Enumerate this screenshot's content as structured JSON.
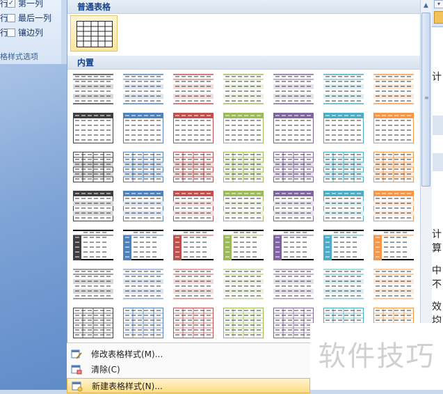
{
  "ribbon": {
    "options": [
      {
        "prefix": "行",
        "label": "第一列",
        "checked": true
      },
      {
        "prefix": "行",
        "label": "最后一列",
        "checked": false
      },
      {
        "prefix": "行",
        "label": "镶边列",
        "checked": false
      }
    ],
    "group_label": "格样式选项"
  },
  "gallery": {
    "plain_section": "普通表格",
    "builtin_section": "内置",
    "style_colors": [
      "#3f3f3f",
      "#4f81bd",
      "#c0504d",
      "#9bbb59",
      "#8064a2",
      "#4bacc6",
      "#f79646"
    ],
    "tint_colors": [
      "#d9d9d9",
      "#dbe5f1",
      "#f2dcdb",
      "#ebf1de",
      "#e5e0ec",
      "#daeef3",
      "#fde9d9"
    ],
    "row_kinds": [
      "light-lines",
      "header",
      "grid",
      "banded",
      "first-col",
      "light-shaded",
      "light-grid"
    ]
  },
  "menu": {
    "items": [
      {
        "label": "修改表格样式(M)...",
        "icon": "modify-style-icon",
        "highlight": false
      },
      {
        "label": "清除(C)",
        "icon": "clear-style-icon",
        "highlight": false
      },
      {
        "label": "新建表格样式(N)...",
        "icon": "new-style-icon",
        "highlight": true
      }
    ]
  },
  "document": {
    "fragments": [
      "计",
      "计算",
      "中不",
      "效均"
    ]
  },
  "watermark": "软件技巧"
}
